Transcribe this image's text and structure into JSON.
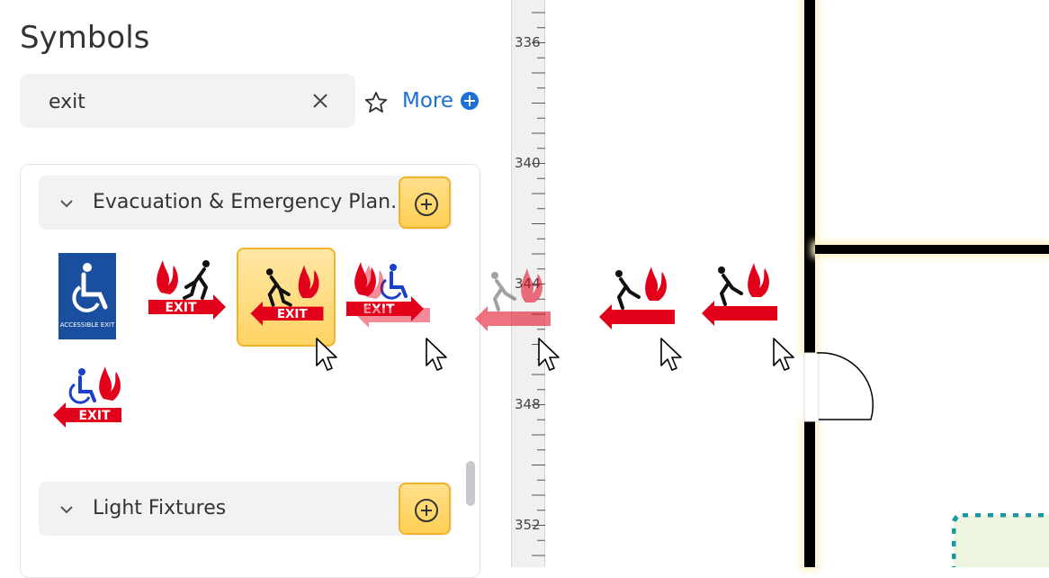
{
  "panel": {
    "title": "Symbols"
  },
  "search": {
    "value": "exit",
    "placeholder": ""
  },
  "more": {
    "label": "More"
  },
  "categories": [
    {
      "label": "Evacuation & Emergency Plan...",
      "expanded": true
    },
    {
      "label": "Light Fixtures",
      "expanded": false
    }
  ],
  "symbols": [
    {
      "name": "accessible-exit",
      "text": "ACCESSIBLE EXIT"
    },
    {
      "name": "exit-right",
      "text": "EXIT"
    },
    {
      "name": "exit-left",
      "text": "EXIT",
      "selected": true
    },
    {
      "name": "exit-wheelchair-right",
      "text": "EXIT"
    },
    {
      "name": "exit-wheelchair-left",
      "text": "EXIT"
    }
  ],
  "ruler": {
    "ticks": [
      "336",
      "340",
      "344",
      "348",
      "352"
    ]
  },
  "colors": {
    "accent": "#1b6fd6",
    "highlight": "#ffd465",
    "exitRed": "#e3001b"
  }
}
